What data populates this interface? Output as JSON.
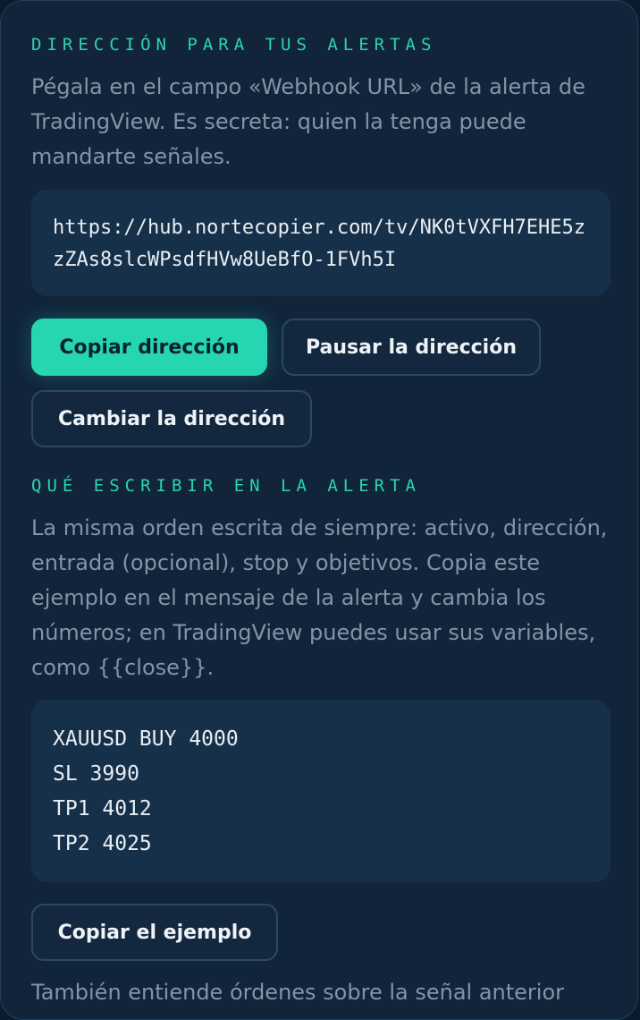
{
  "address_section": {
    "heading": "DIRECCIÓN PARA TUS ALERTAS",
    "description": "Pégala en el campo «Webhook URL» de la alerta de TradingView. Es secreta: quien la tenga puede mandarte señales.",
    "url": "https://hub.nortecopier.com/tv/NK0tVXFH7EHE5zzZAs8slcWPsdfHVw8UeBfO-1FVh5I",
    "buttons": {
      "copy": "Copiar dirección",
      "pause": "Pausar la dirección",
      "change": "Cambiar la dirección"
    }
  },
  "message_section": {
    "heading": "QUÉ ESCRIBIR EN LA ALERTA",
    "description": "La misma orden escrita de siempre: activo, dirección, entrada (opcional), stop y objetivos. Copia este ejemplo en el mensaje de la alerta y cambia los números; en TradingView puedes usar sus variables, como {{close}}.",
    "example_lines": [
      "XAUUSD BUY 4000",
      "SL 3990",
      "TP1 4012",
      "TP2 4025"
    ],
    "copy_example_button": "Copiar el ejemplo",
    "footer_text": "También entiende órdenes sobre la señal anterior"
  },
  "colors": {
    "accent": "#25d6b1",
    "card_background": "#11243a",
    "code_background": "#173049",
    "muted_text": "#8194a8"
  }
}
